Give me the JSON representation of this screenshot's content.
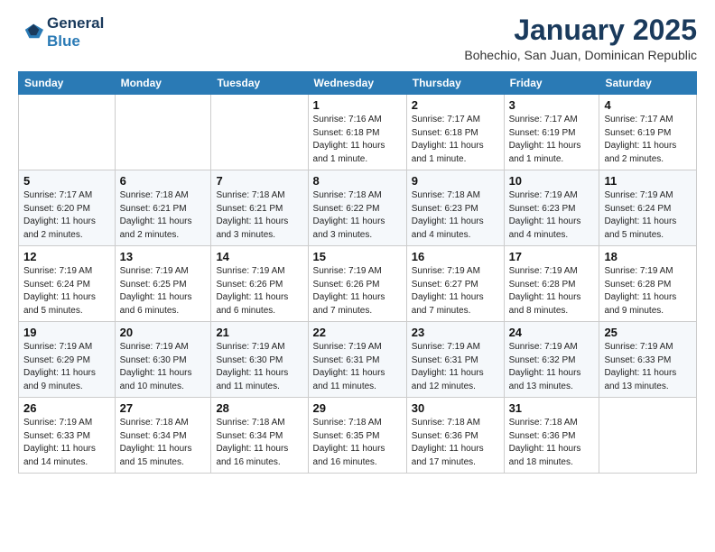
{
  "header": {
    "logo_line1": "General",
    "logo_line2": "Blue",
    "month": "January 2025",
    "location": "Bohechio, San Juan, Dominican Republic"
  },
  "weekdays": [
    "Sunday",
    "Monday",
    "Tuesday",
    "Wednesday",
    "Thursday",
    "Friday",
    "Saturday"
  ],
  "weeks": [
    [
      {
        "day": "",
        "info": ""
      },
      {
        "day": "",
        "info": ""
      },
      {
        "day": "",
        "info": ""
      },
      {
        "day": "1",
        "info": "Sunrise: 7:16 AM\nSunset: 6:18 PM\nDaylight: 11 hours\nand 1 minute."
      },
      {
        "day": "2",
        "info": "Sunrise: 7:17 AM\nSunset: 6:18 PM\nDaylight: 11 hours\nand 1 minute."
      },
      {
        "day": "3",
        "info": "Sunrise: 7:17 AM\nSunset: 6:19 PM\nDaylight: 11 hours\nand 1 minute."
      },
      {
        "day": "4",
        "info": "Sunrise: 7:17 AM\nSunset: 6:19 PM\nDaylight: 11 hours\nand 2 minutes."
      }
    ],
    [
      {
        "day": "5",
        "info": "Sunrise: 7:17 AM\nSunset: 6:20 PM\nDaylight: 11 hours\nand 2 minutes."
      },
      {
        "day": "6",
        "info": "Sunrise: 7:18 AM\nSunset: 6:21 PM\nDaylight: 11 hours\nand 2 minutes."
      },
      {
        "day": "7",
        "info": "Sunrise: 7:18 AM\nSunset: 6:21 PM\nDaylight: 11 hours\nand 3 minutes."
      },
      {
        "day": "8",
        "info": "Sunrise: 7:18 AM\nSunset: 6:22 PM\nDaylight: 11 hours\nand 3 minutes."
      },
      {
        "day": "9",
        "info": "Sunrise: 7:18 AM\nSunset: 6:23 PM\nDaylight: 11 hours\nand 4 minutes."
      },
      {
        "day": "10",
        "info": "Sunrise: 7:19 AM\nSunset: 6:23 PM\nDaylight: 11 hours\nand 4 minutes."
      },
      {
        "day": "11",
        "info": "Sunrise: 7:19 AM\nSunset: 6:24 PM\nDaylight: 11 hours\nand 5 minutes."
      }
    ],
    [
      {
        "day": "12",
        "info": "Sunrise: 7:19 AM\nSunset: 6:24 PM\nDaylight: 11 hours\nand 5 minutes."
      },
      {
        "day": "13",
        "info": "Sunrise: 7:19 AM\nSunset: 6:25 PM\nDaylight: 11 hours\nand 6 minutes."
      },
      {
        "day": "14",
        "info": "Sunrise: 7:19 AM\nSunset: 6:26 PM\nDaylight: 11 hours\nand 6 minutes."
      },
      {
        "day": "15",
        "info": "Sunrise: 7:19 AM\nSunset: 6:26 PM\nDaylight: 11 hours\nand 7 minutes."
      },
      {
        "day": "16",
        "info": "Sunrise: 7:19 AM\nSunset: 6:27 PM\nDaylight: 11 hours\nand 7 minutes."
      },
      {
        "day": "17",
        "info": "Sunrise: 7:19 AM\nSunset: 6:28 PM\nDaylight: 11 hours\nand 8 minutes."
      },
      {
        "day": "18",
        "info": "Sunrise: 7:19 AM\nSunset: 6:28 PM\nDaylight: 11 hours\nand 9 minutes."
      }
    ],
    [
      {
        "day": "19",
        "info": "Sunrise: 7:19 AM\nSunset: 6:29 PM\nDaylight: 11 hours\nand 9 minutes."
      },
      {
        "day": "20",
        "info": "Sunrise: 7:19 AM\nSunset: 6:30 PM\nDaylight: 11 hours\nand 10 minutes."
      },
      {
        "day": "21",
        "info": "Sunrise: 7:19 AM\nSunset: 6:30 PM\nDaylight: 11 hours\nand 11 minutes."
      },
      {
        "day": "22",
        "info": "Sunrise: 7:19 AM\nSunset: 6:31 PM\nDaylight: 11 hours\nand 11 minutes."
      },
      {
        "day": "23",
        "info": "Sunrise: 7:19 AM\nSunset: 6:31 PM\nDaylight: 11 hours\nand 12 minutes."
      },
      {
        "day": "24",
        "info": "Sunrise: 7:19 AM\nSunset: 6:32 PM\nDaylight: 11 hours\nand 13 minutes."
      },
      {
        "day": "25",
        "info": "Sunrise: 7:19 AM\nSunset: 6:33 PM\nDaylight: 11 hours\nand 13 minutes."
      }
    ],
    [
      {
        "day": "26",
        "info": "Sunrise: 7:19 AM\nSunset: 6:33 PM\nDaylight: 11 hours\nand 14 minutes."
      },
      {
        "day": "27",
        "info": "Sunrise: 7:18 AM\nSunset: 6:34 PM\nDaylight: 11 hours\nand 15 minutes."
      },
      {
        "day": "28",
        "info": "Sunrise: 7:18 AM\nSunset: 6:34 PM\nDaylight: 11 hours\nand 16 minutes."
      },
      {
        "day": "29",
        "info": "Sunrise: 7:18 AM\nSunset: 6:35 PM\nDaylight: 11 hours\nand 16 minutes."
      },
      {
        "day": "30",
        "info": "Sunrise: 7:18 AM\nSunset: 6:36 PM\nDaylight: 11 hours\nand 17 minutes."
      },
      {
        "day": "31",
        "info": "Sunrise: 7:18 AM\nSunset: 6:36 PM\nDaylight: 11 hours\nand 18 minutes."
      },
      {
        "day": "",
        "info": ""
      }
    ]
  ]
}
